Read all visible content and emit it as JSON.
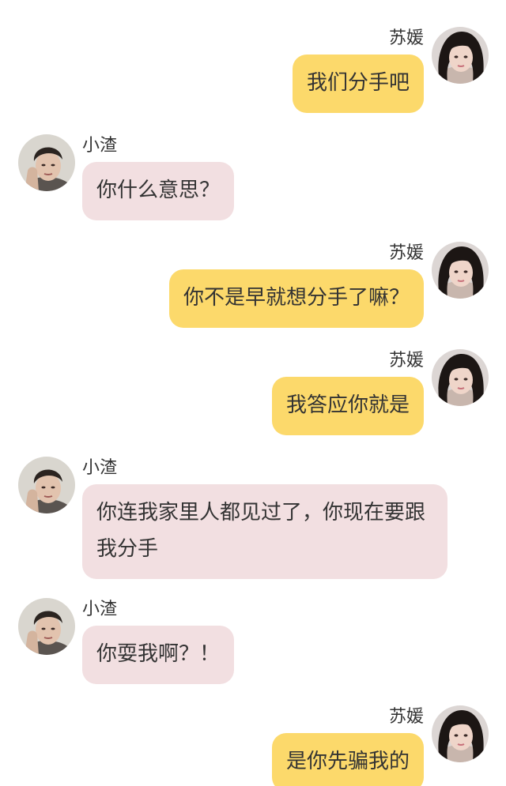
{
  "conversation": {
    "messages": [
      {
        "sender": "苏媛",
        "side": "right",
        "text": "我们分手吧"
      },
      {
        "sender": "小渣",
        "side": "left",
        "text": "你什么意思？"
      },
      {
        "sender": "苏媛",
        "side": "right",
        "text": "你不是早就想分手了嘛？"
      },
      {
        "sender": "苏媛",
        "side": "right",
        "text": "我答应你就是"
      },
      {
        "sender": "小渣",
        "side": "left",
        "text": "你连我家里人都见过了，你现在要跟我分手"
      },
      {
        "sender": "小渣",
        "side": "left",
        "text": "你耍我啊？！"
      },
      {
        "sender": "苏媛",
        "side": "right",
        "text": "是你先骗我的"
      }
    ]
  },
  "colors": {
    "self_bubble": "#fcd96b",
    "other_bubble": "#f2dfe1",
    "text": "#333333",
    "background": "#ffffff"
  },
  "icons": {
    "self_avatar": "avatar-woman-icon",
    "other_avatar": "avatar-man-icon"
  }
}
